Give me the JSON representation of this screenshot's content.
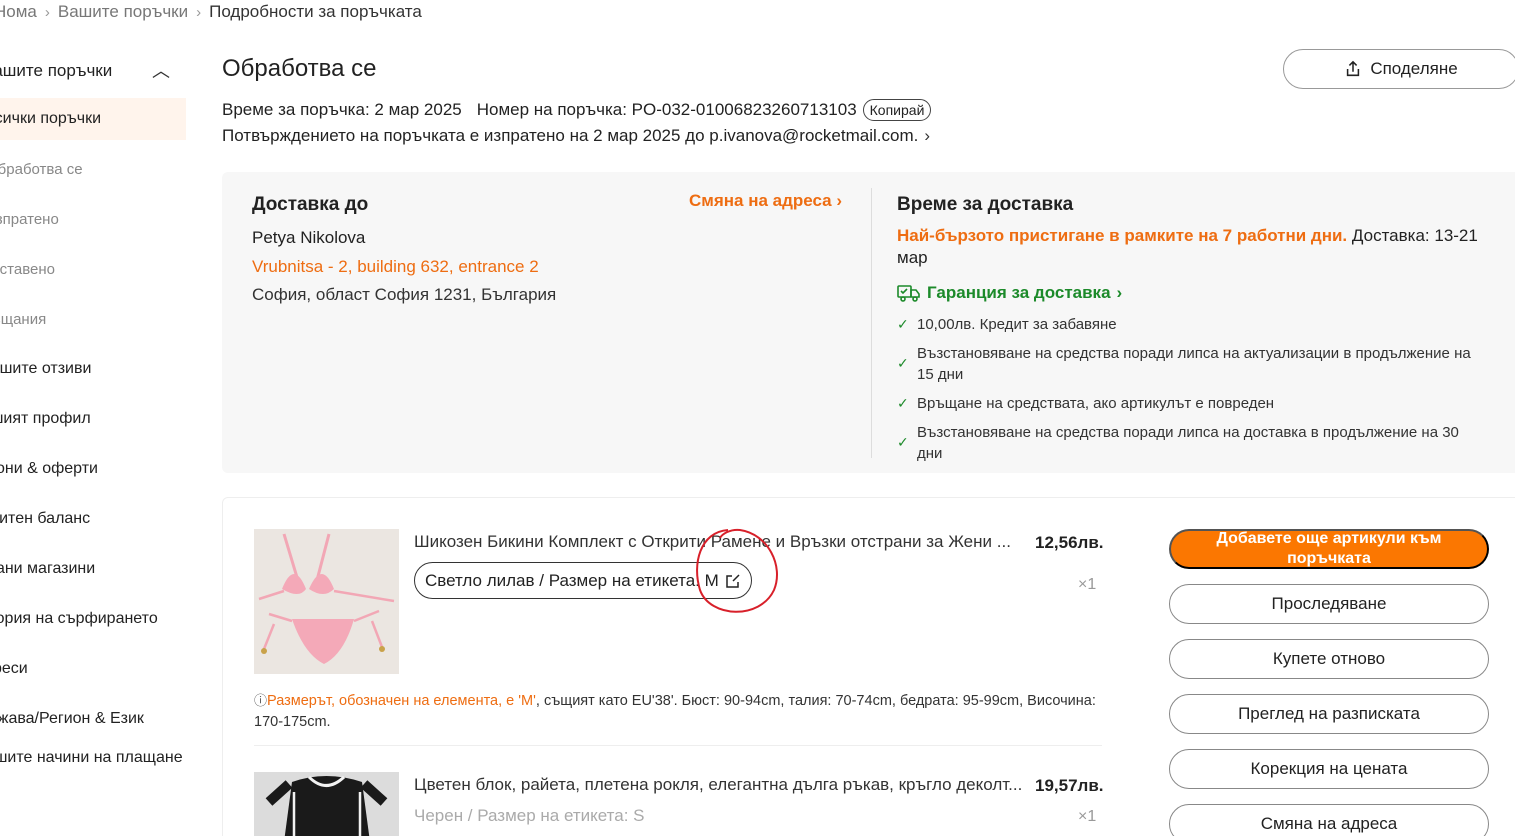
{
  "breadcrumb": {
    "home": "Нома",
    "orders": "Вашите поръчки",
    "current": "Подробности за поръчката"
  },
  "sidebar": {
    "group_label": "Вашите поръчки",
    "items": [
      {
        "label": "Всички поръчки"
      },
      {
        "label": "Обработва се"
      },
      {
        "label": "Изпратено"
      },
      {
        "label": "Доставено"
      },
      {
        "label": "Връщания"
      },
      {
        "label": "Вашите отзиви"
      },
      {
        "label": "Вашият профил"
      },
      {
        "label": "Купони & оферти"
      },
      {
        "label": "Кредитен баланс"
      },
      {
        "label": "Последвани магазини"
      },
      {
        "label": "История на сърфирането"
      },
      {
        "label": "Адреси"
      },
      {
        "label": "Държава/Регион & Език"
      },
      {
        "label": "Вашите начини на плащане"
      }
    ]
  },
  "header": {
    "status": "Обработва се",
    "share_label": "Споделяне",
    "order_time_label": "Време за поръчка:",
    "order_time": "2 мар 2025",
    "order_number_label": "Номер на поръчка:",
    "order_number": "PO-032-01006823260713103",
    "copy_label": "Копирай",
    "confirmation": "Потвърждението на поръчката е изпратено на 2 мар 2025 до p.ivanova@rocketmail.com."
  },
  "shipping": {
    "title": "Доставка до",
    "change_address": "Смяна на адреса",
    "name": "Petya Nikolova",
    "street": "Vrubnitsa - 2, building 632, entrance 2",
    "city": "София, област София 1231, България"
  },
  "delivery_time": {
    "title": "Време за доставка",
    "fastest": "Най-бързото пристигане в рамките на 7 работни дни.",
    "window": "Доставка: 13-21 мар",
    "guarantee_label": "Гаранция за доставка",
    "guarantees": [
      "10,00лв. Кредит за забавяне",
      "Възстановяване на средства поради липса на актуализации в продължение на 15 дни",
      "Връщане на средствата, ако артикулът е повреден",
      "Възстановяване на средства поради липса на доставка в продължение на 30 дни"
    ]
  },
  "items": [
    {
      "title": "Шикозен Бикини Комплект с Открити Рамене и Връзки отстрани за Жени ...",
      "price": "12,56лв.",
      "qty": "×1",
      "variant": "Светло лилав / Размер на етикета: M",
      "size_note_highlight": "Размерът, обозначен на елемента, е 'M'",
      "size_note_rest": ", същият като EU'38'. Бюст: 90-94cm, талия: 70-74cm, бедрата: 95-99cm, Височина: 170-175cm."
    },
    {
      "title": "Цветен блок, райета, плетена рокля, елегантна дълга ръкав, кръгло деколт...",
      "price": "19,57лв.",
      "qty": "×1",
      "variant": "Черен / Размер на етикета: S"
    }
  ],
  "actions": {
    "add_more": "Добавете още артикули към поръчката",
    "track": "Проследяване",
    "buy_again": "Купете отново",
    "view_receipt": "Преглед на разписката",
    "price_adjust": "Корекция на цената",
    "change_address": "Смяна на адреса"
  },
  "colors": {
    "accent_orange": "#fb7701",
    "link_orange": "#ee6d12",
    "guarantee_green": "#1c8a2a",
    "annotation_red": "#d8202a"
  }
}
